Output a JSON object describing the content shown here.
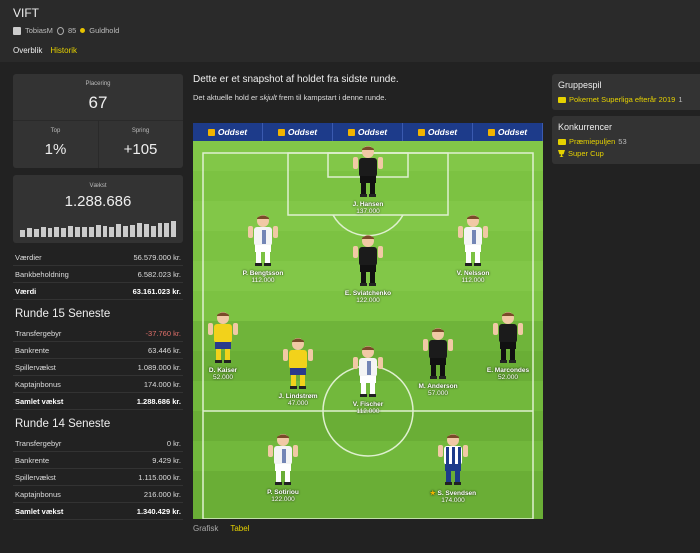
{
  "header": {
    "team_name": "VIFT",
    "owner": "TobiasM",
    "medals": "85",
    "tier": "Guldhold",
    "tabs": [
      {
        "label": "Overblik",
        "active": false
      },
      {
        "label": "Historik",
        "active": true
      }
    ]
  },
  "stats": {
    "placering_label": "Placering",
    "placering_value": "67",
    "top_label": "Top",
    "top_value": "1%",
    "spring_label": "Spring",
    "spring_value": "+105",
    "vaekst_label": "Vækst",
    "vaekst_value": "1.288.686",
    "vaekst_bars": [
      0.45,
      0.55,
      0.5,
      0.6,
      0.55,
      0.65,
      0.55,
      0.7,
      0.6,
      0.65,
      0.6,
      0.75,
      0.7,
      0.65,
      0.8,
      0.7,
      0.75,
      0.85,
      0.8,
      0.7,
      0.9,
      0.85,
      1.0
    ]
  },
  "summary": [
    {
      "label": "Værdier",
      "value": "56.579.000 kr."
    },
    {
      "label": "Bankbeholdning",
      "value": "6.582.023 kr."
    },
    {
      "label": "Værdi",
      "value": "63.161.023 kr.",
      "total": true
    }
  ],
  "round15": {
    "title": "Runde 15 Seneste",
    "rows": [
      {
        "label": "Transfergebyr",
        "value": "-37.760 kr.",
        "negative": true
      },
      {
        "label": "Bankrente",
        "value": "63.446 kr."
      },
      {
        "label": "Spillervækst",
        "value": "1.089.000 kr."
      },
      {
        "label": "Kaptajnbonus",
        "value": "174.000 kr."
      },
      {
        "label": "Samlet vækst",
        "value": "1.288.686 kr.",
        "total": true
      }
    ]
  },
  "round14": {
    "title": "Runde 14 Seneste",
    "rows": [
      {
        "label": "Transfergebyr",
        "value": "0 kr."
      },
      {
        "label": "Bankrente",
        "value": "9.429 kr."
      },
      {
        "label": "Spillervækst",
        "value": "1.115.000 kr."
      },
      {
        "label": "Kaptajnbonus",
        "value": "216.000 kr."
      },
      {
        "label": "Samlet vækst",
        "value": "1.340.429 kr.",
        "total": true
      }
    ]
  },
  "center": {
    "title": "Dette er et snapshot af holdet fra sidste runde.",
    "subtitle_pre": "Det aktuelle hold er ",
    "subtitle_em": "skjult",
    "subtitle_post": " frem til kampstart i denne runde.",
    "ad_text": "Oddset",
    "view_tabs": [
      {
        "label": "Grafisk",
        "active": false
      },
      {
        "label": "Tabel",
        "active": true
      }
    ]
  },
  "players": [
    {
      "name": "J. Hansen",
      "value": "137.000",
      "kit": "black"
    },
    {
      "name": "P. Bengtsson",
      "value": "112.000",
      "kit": "white"
    },
    {
      "name": "E. Sviatchenko",
      "value": "122.000",
      "kit": "black"
    },
    {
      "name": "V. Nelsson",
      "value": "112.000",
      "kit": "white"
    },
    {
      "name": "D. Kaiser",
      "value": "52.000",
      "kit": "yellow"
    },
    {
      "name": "J. Lindstrøm",
      "value": "47.000",
      "kit": "yellow"
    },
    {
      "name": "V. Fischer",
      "value": "112.000",
      "kit": "white"
    },
    {
      "name": "M. Anderson",
      "value": "57.000",
      "kit": "black"
    },
    {
      "name": "E. Marcondes",
      "value": "52.000",
      "kit": "black"
    },
    {
      "name": "P. Sotiriou",
      "value": "122.000",
      "kit": "white"
    },
    {
      "name": "S. Svendsen",
      "value": "174.000",
      "kit": "stripes",
      "captain": true
    }
  ],
  "colors": {
    "accent": "#e6d200",
    "negative": "#e0706a",
    "pitch_light": "#7cc242",
    "pitch_dark": "#6fb43a",
    "ad_band": "#1d3b8a"
  },
  "right": {
    "gruppespil_title": "Gruppespil",
    "gruppespil_link": "Pokernet Superliga efterår 2019",
    "gruppespil_count": "1",
    "konkurrencer_title": "Konkurrencer",
    "konkurrencer": [
      {
        "label": "Præmiepuljen",
        "count": "53",
        "icon": "group-icon"
      },
      {
        "label": "Super Cup",
        "count": "",
        "icon": "cup-icon"
      }
    ]
  }
}
